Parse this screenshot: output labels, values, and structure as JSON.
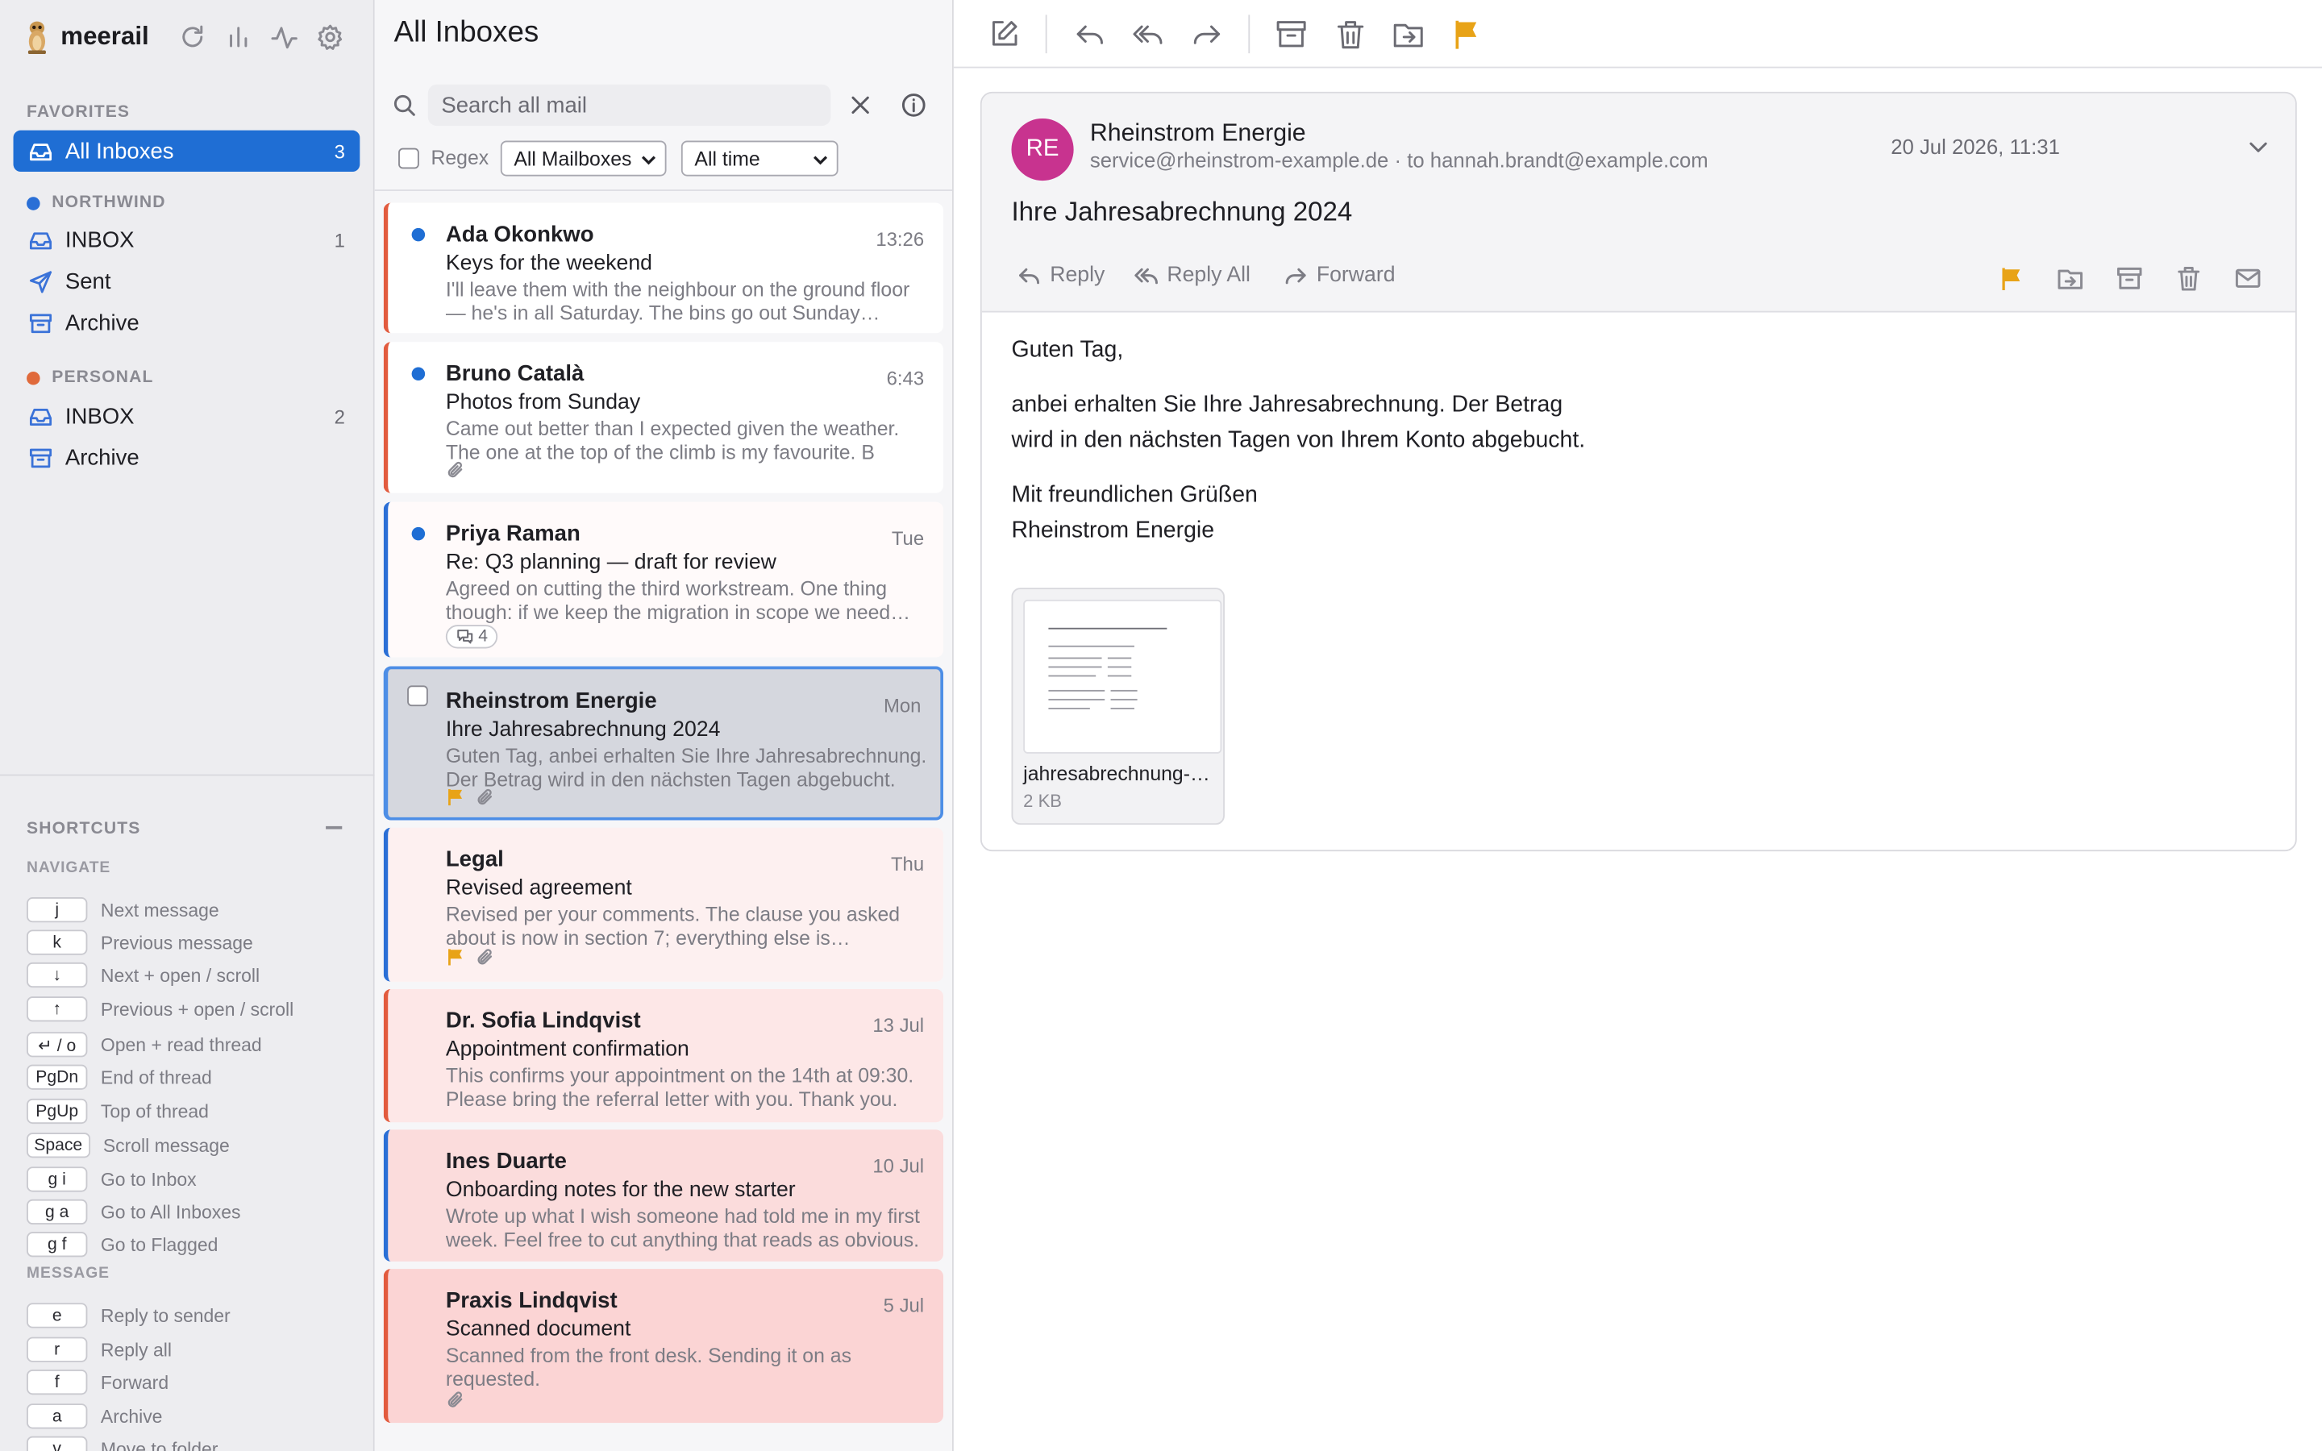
{
  "app": {
    "name": "meerail"
  },
  "sidebar": {
    "favorites_heading": "FAVORITES",
    "all_inboxes": {
      "label": "All Inboxes",
      "count": "3"
    },
    "accounts": [
      {
        "name": "NORTHWIND",
        "color": "#2a6fd6",
        "folders": [
          {
            "label": "INBOX",
            "count": "1",
            "icon": "inbox-icon"
          },
          {
            "label": "Sent",
            "count": "",
            "icon": "send-icon"
          },
          {
            "label": "Archive",
            "count": "",
            "icon": "archive-icon"
          }
        ]
      },
      {
        "name": "PERSONAL",
        "color": "#e06a3b",
        "folders": [
          {
            "label": "INBOX",
            "count": "2",
            "icon": "inbox-icon"
          },
          {
            "label": "Archive",
            "count": "",
            "icon": "archive-icon"
          }
        ]
      }
    ]
  },
  "shortcuts": {
    "title": "SHORTCUTS",
    "navigate_heading": "NAVIGATE",
    "navigate": [
      {
        "key": "j",
        "label": "Next message"
      },
      {
        "key": "k",
        "label": "Previous message"
      },
      {
        "key": "↓",
        "label": "Next + open / scroll"
      },
      {
        "key": "↑",
        "label": "Previous + open / scroll"
      },
      {
        "key": "↵ / o",
        "label": "Open + read thread"
      },
      {
        "key": "PgDn",
        "label": "End of thread"
      },
      {
        "key": "PgUp",
        "label": "Top of thread"
      },
      {
        "key": "Space",
        "label": "Scroll message"
      },
      {
        "key": "g i",
        "label": "Go to Inbox"
      },
      {
        "key": "g a",
        "label": "Go to All Inboxes"
      },
      {
        "key": "g f",
        "label": "Go to Flagged"
      }
    ],
    "message_heading": "MESSAGE",
    "message": [
      {
        "key": "e",
        "label": "Reply to sender"
      },
      {
        "key": "r",
        "label": "Reply all"
      },
      {
        "key": "f",
        "label": "Forward"
      },
      {
        "key": "a",
        "label": "Archive"
      },
      {
        "key": "v",
        "label": "Move to folder"
      }
    ]
  },
  "list": {
    "title": "All Inboxes",
    "search_placeholder": "Search all mail",
    "regex_label": "Regex",
    "mailbox_filter": "All Mailboxes",
    "time_filter": "All time",
    "messages": [
      {
        "from": "Ada Okonkwo",
        "date": "13:26",
        "subject": "Keys for the weekend",
        "preview": "I'll leave them with the neighbour on the ground floor — he's in all Saturday. The bins go out Sunday evening.",
        "unread": true,
        "bg": "#ffffff",
        "border": "#e25b3e"
      },
      {
        "from": "Bruno Català",
        "date": "6:43",
        "subject": "Photos from Sunday",
        "preview": "Came out better than I expected given the weather. The one at the top of the climb is my favourite. B",
        "unread": true,
        "bg": "#ffffff",
        "border": "#e25b3e",
        "attachment": true
      },
      {
        "from": "Priya Raman",
        "date": "Tue",
        "subject": "Re: Q3 planning — draft for review",
        "preview": "Agreed on cutting the third workstream. One thing though: if we keep the migration in scope we need another week.",
        "unread": true,
        "bg": "#fffafa",
        "border": "#2a6fd6",
        "thread_count": "4"
      },
      {
        "from": "Rheinstrom Energie",
        "date": "Mon",
        "subject": "Ihre Jahresabrechnung 2024",
        "preview": "Guten Tag, anbei erhalten Sie Ihre Jahresabrechnung. Der Betrag wird in den nächsten Tagen abgebucht.",
        "selected": true,
        "flagged": true,
        "attachment": true
      },
      {
        "from": "Legal",
        "date": "Thu",
        "subject": "Revised agreement",
        "preview": "Revised per your comments. The clause you asked about is now in section 7; everything else is unchanged.",
        "bg": "#fdf0f0",
        "border": "#2a6fd6",
        "flagged": true,
        "attachment": true
      },
      {
        "from": "Dr. Sofia Lindqvist",
        "date": "13 Jul",
        "subject": "Appointment confirmation",
        "preview": "This confirms your appointment on the 14th at 09:30. Please bring the referral letter with you. Thank you.",
        "bg": "#fde7e7",
        "border": "#e25b3e"
      },
      {
        "from": "Ines Duarte",
        "date": "10 Jul",
        "subject": "Onboarding notes for the new starter",
        "preview": "Wrote up what I wish someone had told me in my first week. Feel free to cut anything that reads as obvious.",
        "bg": "#fbdcdc",
        "border": "#2a6fd6"
      },
      {
        "from": "Praxis Lindqvist",
        "date": "5 Jul",
        "subject": "Scanned document",
        "preview": "Scanned from the front desk. Sending it on as requested.",
        "bg": "#fbd4d4",
        "border": "#e25b3e",
        "attachment": true
      }
    ]
  },
  "reader": {
    "avatar_initials": "RE",
    "avatar_color": "#c8338f",
    "sender": "Rheinstrom Energie",
    "address_line": "service@rheinstrom-example.de · to hannah.brandt@example.com",
    "date": "20 Jul 2026, 11:31",
    "subject": "Ihre Jahresabrechnung 2024",
    "actions": {
      "reply": "Reply",
      "reply_all": "Reply All",
      "forward": "Forward"
    },
    "body": {
      "greeting": "Guten Tag,",
      "line1": "anbei erhalten Sie Ihre Jahresabrechnung. Der Betrag",
      "line2": "wird in den nächsten Tagen von Ihrem Konto abgebucht.",
      "closing1": "Mit freundlichen Grüßen",
      "closing2": "Rheinstrom Energie"
    },
    "attachment": {
      "name": "jahresabrechnung-…",
      "size": "2 KB"
    }
  },
  "colors": {
    "accent": "#1f6ed4",
    "flag": "#e8a317"
  }
}
